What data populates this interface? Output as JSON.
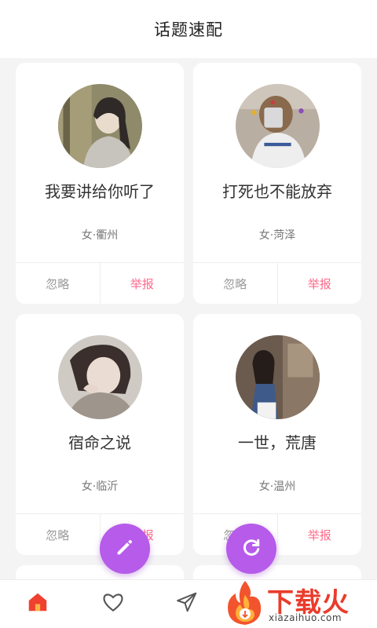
{
  "header": {
    "title": "话题速配"
  },
  "cards": [
    {
      "name": "我要讲给你听了",
      "location": "女·衢州",
      "ignore_label": "忽略",
      "report_label": "举报"
    },
    {
      "name": "打死也不能放弃",
      "location": "女·菏泽",
      "ignore_label": "忽略",
      "report_label": "举报"
    },
    {
      "name": "宿命之说",
      "location": "女·临沂",
      "ignore_label": "忽略",
      "report_label": "举报"
    },
    {
      "name": "一世，荒唐",
      "location": "女·温州",
      "ignore_label": "忽略",
      "report_label": "举报"
    }
  ],
  "fabs": {
    "edit_icon": "pencil-icon",
    "refresh_icon": "refresh-icon"
  },
  "tabbar": {
    "icons": [
      "home-icon",
      "heart-icon",
      "send-icon"
    ]
  },
  "watermark": {
    "text": "下载火",
    "sub": "xiazaihuo.com"
  },
  "colors": {
    "accent": "#b65bea",
    "report": "#ff6a8b",
    "home_active": "#f0402f"
  }
}
